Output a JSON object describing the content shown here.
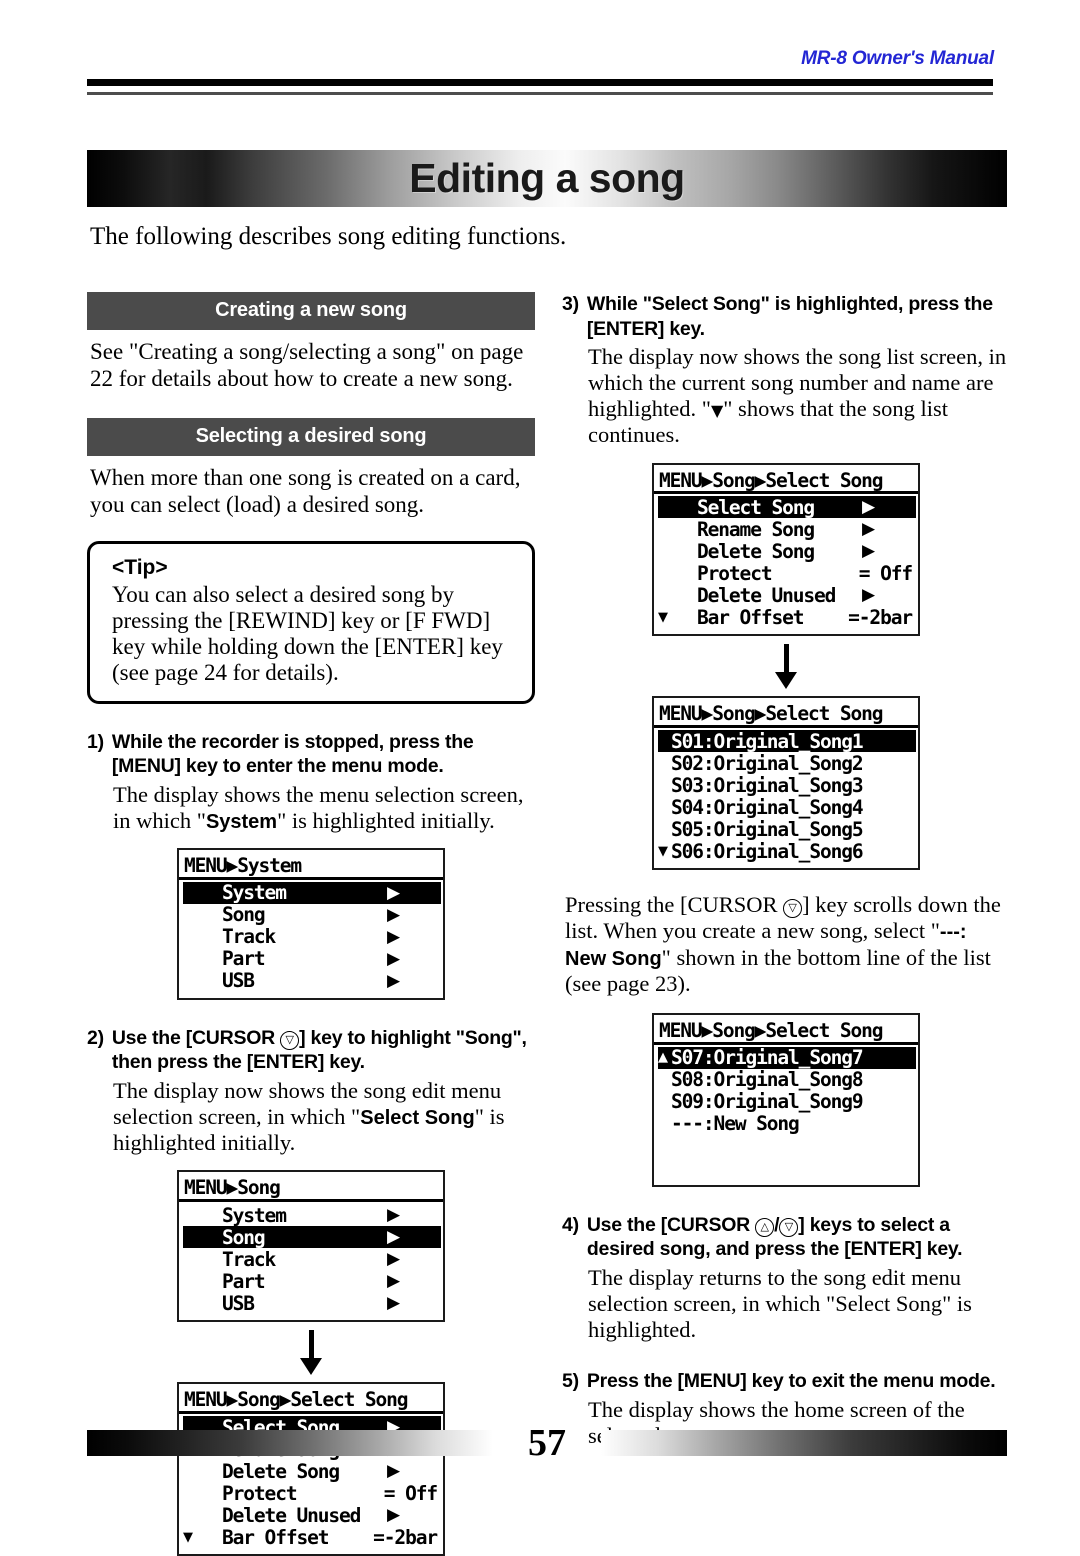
{
  "header": {
    "running_title": "MR-8 Owner's Manual",
    "running_title_color": "#2326d4"
  },
  "title_banner": {
    "title": "Editing a song"
  },
  "intro": "The following describes song editing functions.",
  "left_column": {
    "section_creating": {
      "bar_label": "Creating a new song",
      "body": "See \"Creating a song/selecting a song\" on page 22 for details about how to create a new song."
    },
    "section_selecting": {
      "bar_label": "Selecting a desired song",
      "body": "When more than one song is created on a card, you can select (load) a desired song."
    },
    "tip": {
      "label": "<Tip>",
      "body": "You can also select a desired song by pressing the [REWIND] key or [F FWD] key while holding down the [ENTER] key (see page 24 for details)."
    },
    "step1": {
      "number": "1)",
      "head_part1": "While the recorder is stopped, press the [MENU] key to enter the menu mode.",
      "body_part1": "The display shows the menu selection screen, in which \"",
      "body_bold": "System",
      "body_part2": "\" is highlighted initially."
    },
    "step2": {
      "number": "2)",
      "head_part1": "Use the [CURSOR ",
      "head_cursor": "▽",
      "head_part2": "] key to highlight \"Song\", then press the [ENTER] key.",
      "body_part1": "The display now shows the song edit menu selection screen, in which \"",
      "body_bold": "Select Song",
      "body_part2": "\" is highlighted initially."
    }
  },
  "right_column": {
    "step3": {
      "number": "3)",
      "head": "While \"Select Song\" is highlighted, press the [ENTER] key.",
      "body_part1": "The display now shows the song list screen, in which the current song number and name are highlighted. \"",
      "body_tri": "▼",
      "body_part2": "\" shows that the song list continues."
    },
    "note_scroll": {
      "part1": "Pressing the [CURSOR ",
      "cursor": "▽",
      "part2": "] key scrolls down the list. When you create a new song, select \"",
      "bold": "---: New Song",
      "part3": "\" shown in the bottom line of the list (see page 23)."
    },
    "step4": {
      "number": "4)",
      "head_part1": "Use the [CURSOR ",
      "head_cursor_up": "△",
      "head_slash": "/",
      "head_cursor_down": "▽",
      "head_part2": "] keys to select a desired song, and press the [ENTER] key.",
      "body": "The display returns to the song edit menu selection screen, in which \"Select Song\" is highlighted."
    },
    "step5": {
      "number": "5)",
      "head": "Press the [MENU] key to exit the menu mode.",
      "body": "The display shows the home screen of the selected song."
    }
  },
  "lcd_screens": {
    "menu_system": {
      "title": "MENU▶System",
      "rows": [
        {
          "label": "System",
          "arrow": "▶",
          "highlight": true,
          "scroll": ""
        },
        {
          "label": "Song",
          "arrow": "▶",
          "highlight": false,
          "scroll": ""
        },
        {
          "label": "Track",
          "arrow": "▶",
          "highlight": false,
          "scroll": ""
        },
        {
          "label": "Part",
          "arrow": "▶",
          "highlight": false,
          "scroll": ""
        },
        {
          "label": "USB",
          "arrow": "▶",
          "highlight": false,
          "scroll": ""
        }
      ]
    },
    "menu_song": {
      "title": "MENU▶Song",
      "rows": [
        {
          "label": "System",
          "arrow": "▶",
          "highlight": false,
          "scroll": ""
        },
        {
          "label": "Song",
          "arrow": "▶",
          "highlight": true,
          "scroll": ""
        },
        {
          "label": "Track",
          "arrow": "▶",
          "highlight": false,
          "scroll": ""
        },
        {
          "label": "Part",
          "arrow": "▶",
          "highlight": false,
          "scroll": ""
        },
        {
          "label": "USB",
          "arrow": "▶",
          "highlight": false,
          "scroll": ""
        }
      ]
    },
    "song_edit_menu": {
      "title": "MENU▶Song▶Select Song",
      "rows": [
        {
          "label": "Select Song",
          "arrow": "▶",
          "highlight": true,
          "scroll": ""
        },
        {
          "label": "Rename Song",
          "arrow": "▶",
          "highlight": false,
          "scroll": ""
        },
        {
          "label": "Delete Song",
          "arrow": "▶",
          "highlight": false,
          "scroll": ""
        },
        {
          "label": "Protect",
          "value": "= Off",
          "highlight": false,
          "scroll": ""
        },
        {
          "label": "Delete Unused",
          "arrow": "▶",
          "highlight": false,
          "scroll": ""
        },
        {
          "label": "Bar Offset",
          "value": "=-2bar",
          "highlight": false,
          "scroll": "▼"
        }
      ]
    },
    "song_list_page1": {
      "title": "MENU▶Song▶Select Song",
      "rows": [
        {
          "label": "S01:Original_Song1",
          "highlight": true,
          "scroll": ""
        },
        {
          "label": "S02:Original_Song2",
          "highlight": false,
          "scroll": ""
        },
        {
          "label": "S03:Original_Song3",
          "highlight": false,
          "scroll": ""
        },
        {
          "label": "S04:Original_Song4",
          "highlight": false,
          "scroll": ""
        },
        {
          "label": "S05:Original_Song5",
          "highlight": false,
          "scroll": ""
        },
        {
          "label": "S06:Original_Song6",
          "highlight": false,
          "scroll": "▼"
        }
      ]
    },
    "song_list_page2": {
      "title": "MENU▶Song▶Select Song",
      "rows": [
        {
          "label": "S07:Original_Song7",
          "highlight": true,
          "scroll": "▲"
        },
        {
          "label": "S08:Original_Song8",
          "highlight": false,
          "scroll": ""
        },
        {
          "label": "S09:Original_Song9",
          "highlight": false,
          "scroll": ""
        },
        {
          "label": "---:New Song",
          "highlight": false,
          "scroll": ""
        },
        {
          "label": "",
          "highlight": false,
          "scroll": ""
        },
        {
          "label": "",
          "highlight": false,
          "scroll": ""
        }
      ]
    }
  },
  "footer": {
    "page_number": "57"
  }
}
